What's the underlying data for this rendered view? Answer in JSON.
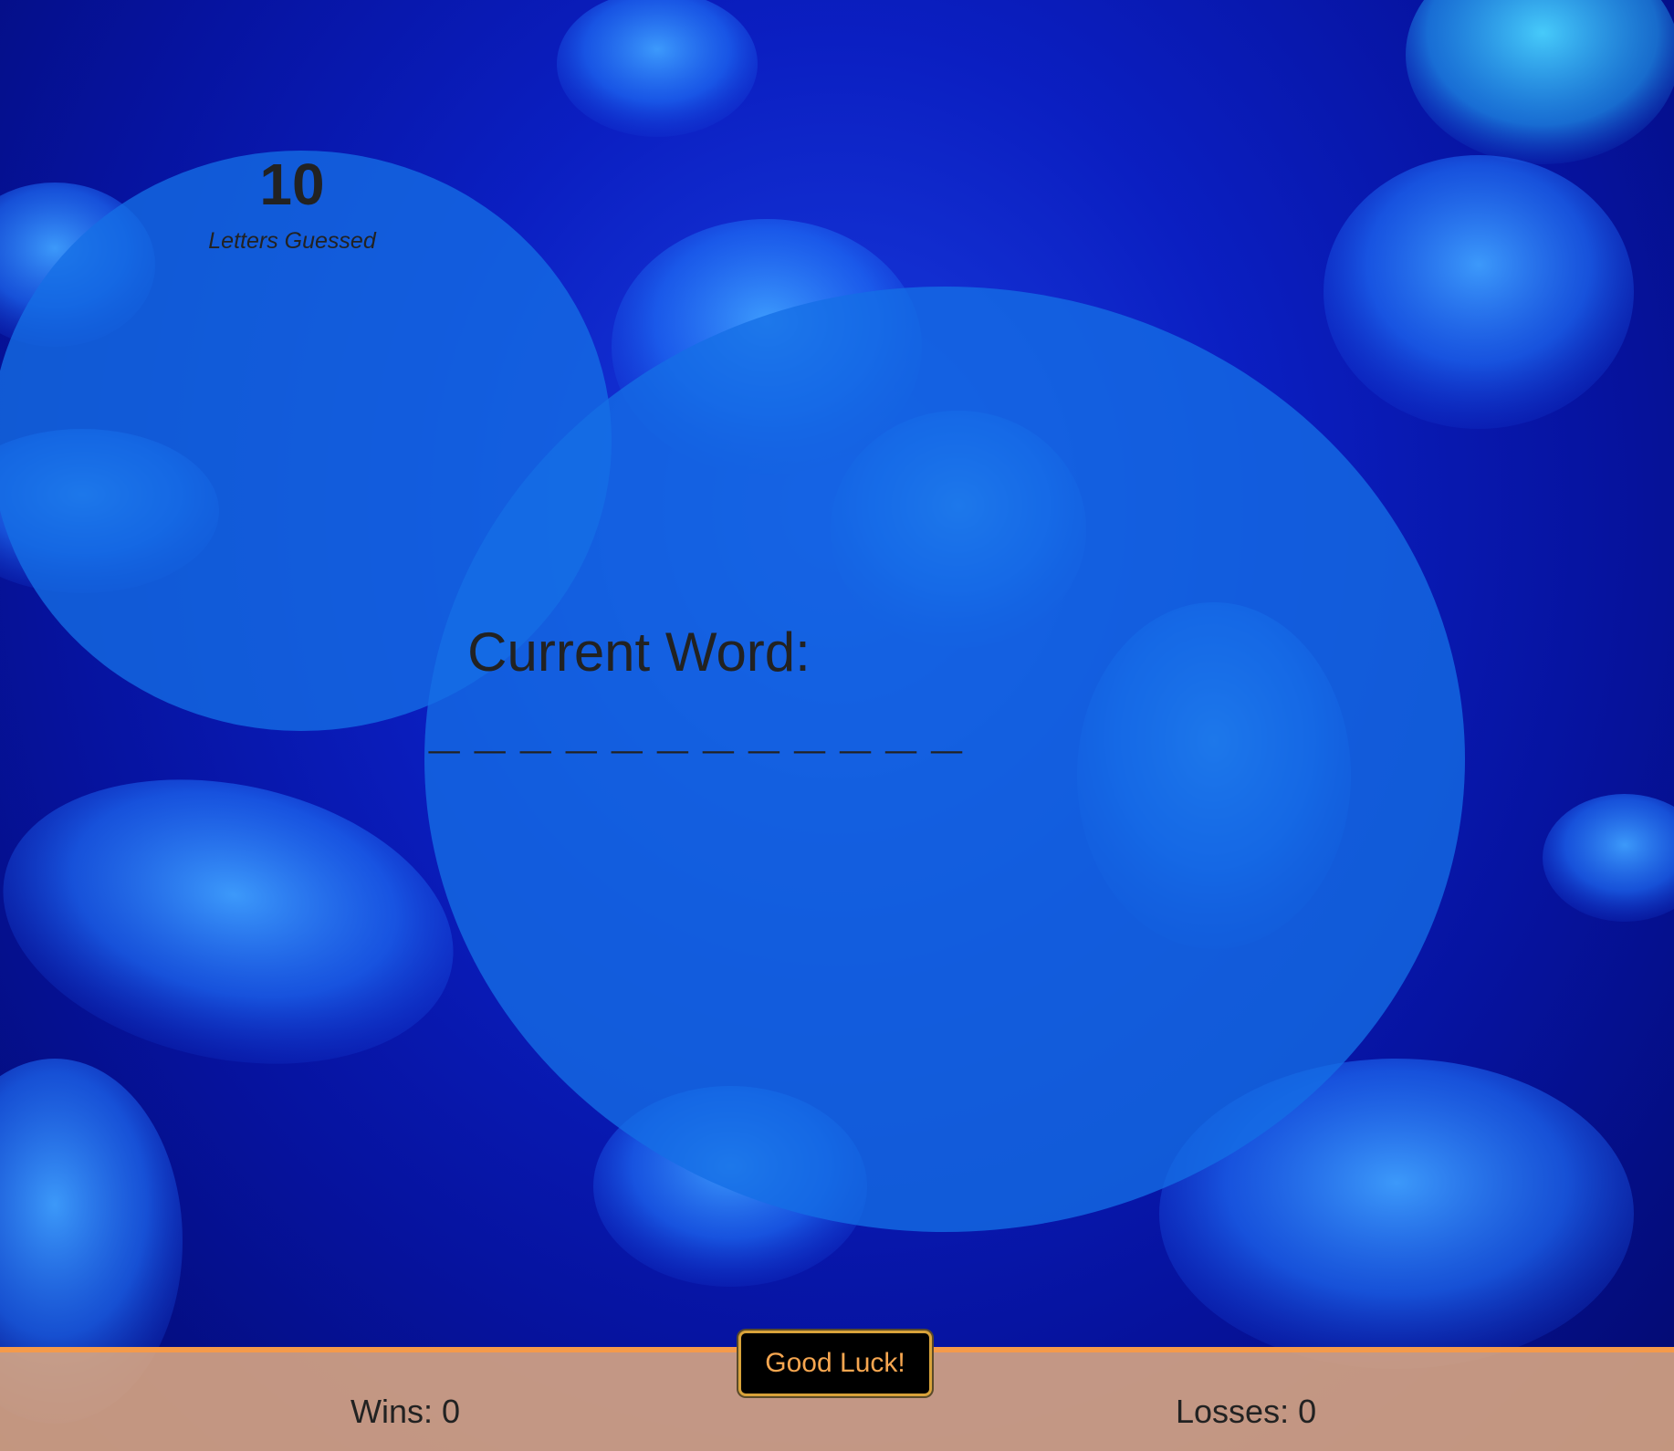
{
  "game": {
    "letters_guessed_count": "10",
    "letters_guessed_label": "Letters Guessed",
    "current_word_label": "Current Word:",
    "current_word_blanks": "_ _ _ _ _ _ _ _ _ _ _ _"
  },
  "footer": {
    "wins_text": "Wins: 0",
    "losses_text": "Losses: 0",
    "luck_button_label": "Good Luck!"
  },
  "colors": {
    "background": "#0b1fc2",
    "bubble": "#146ee6",
    "footer": "#deaa82",
    "footer_border": "#f59a4a",
    "button_text": "#f6a650"
  }
}
